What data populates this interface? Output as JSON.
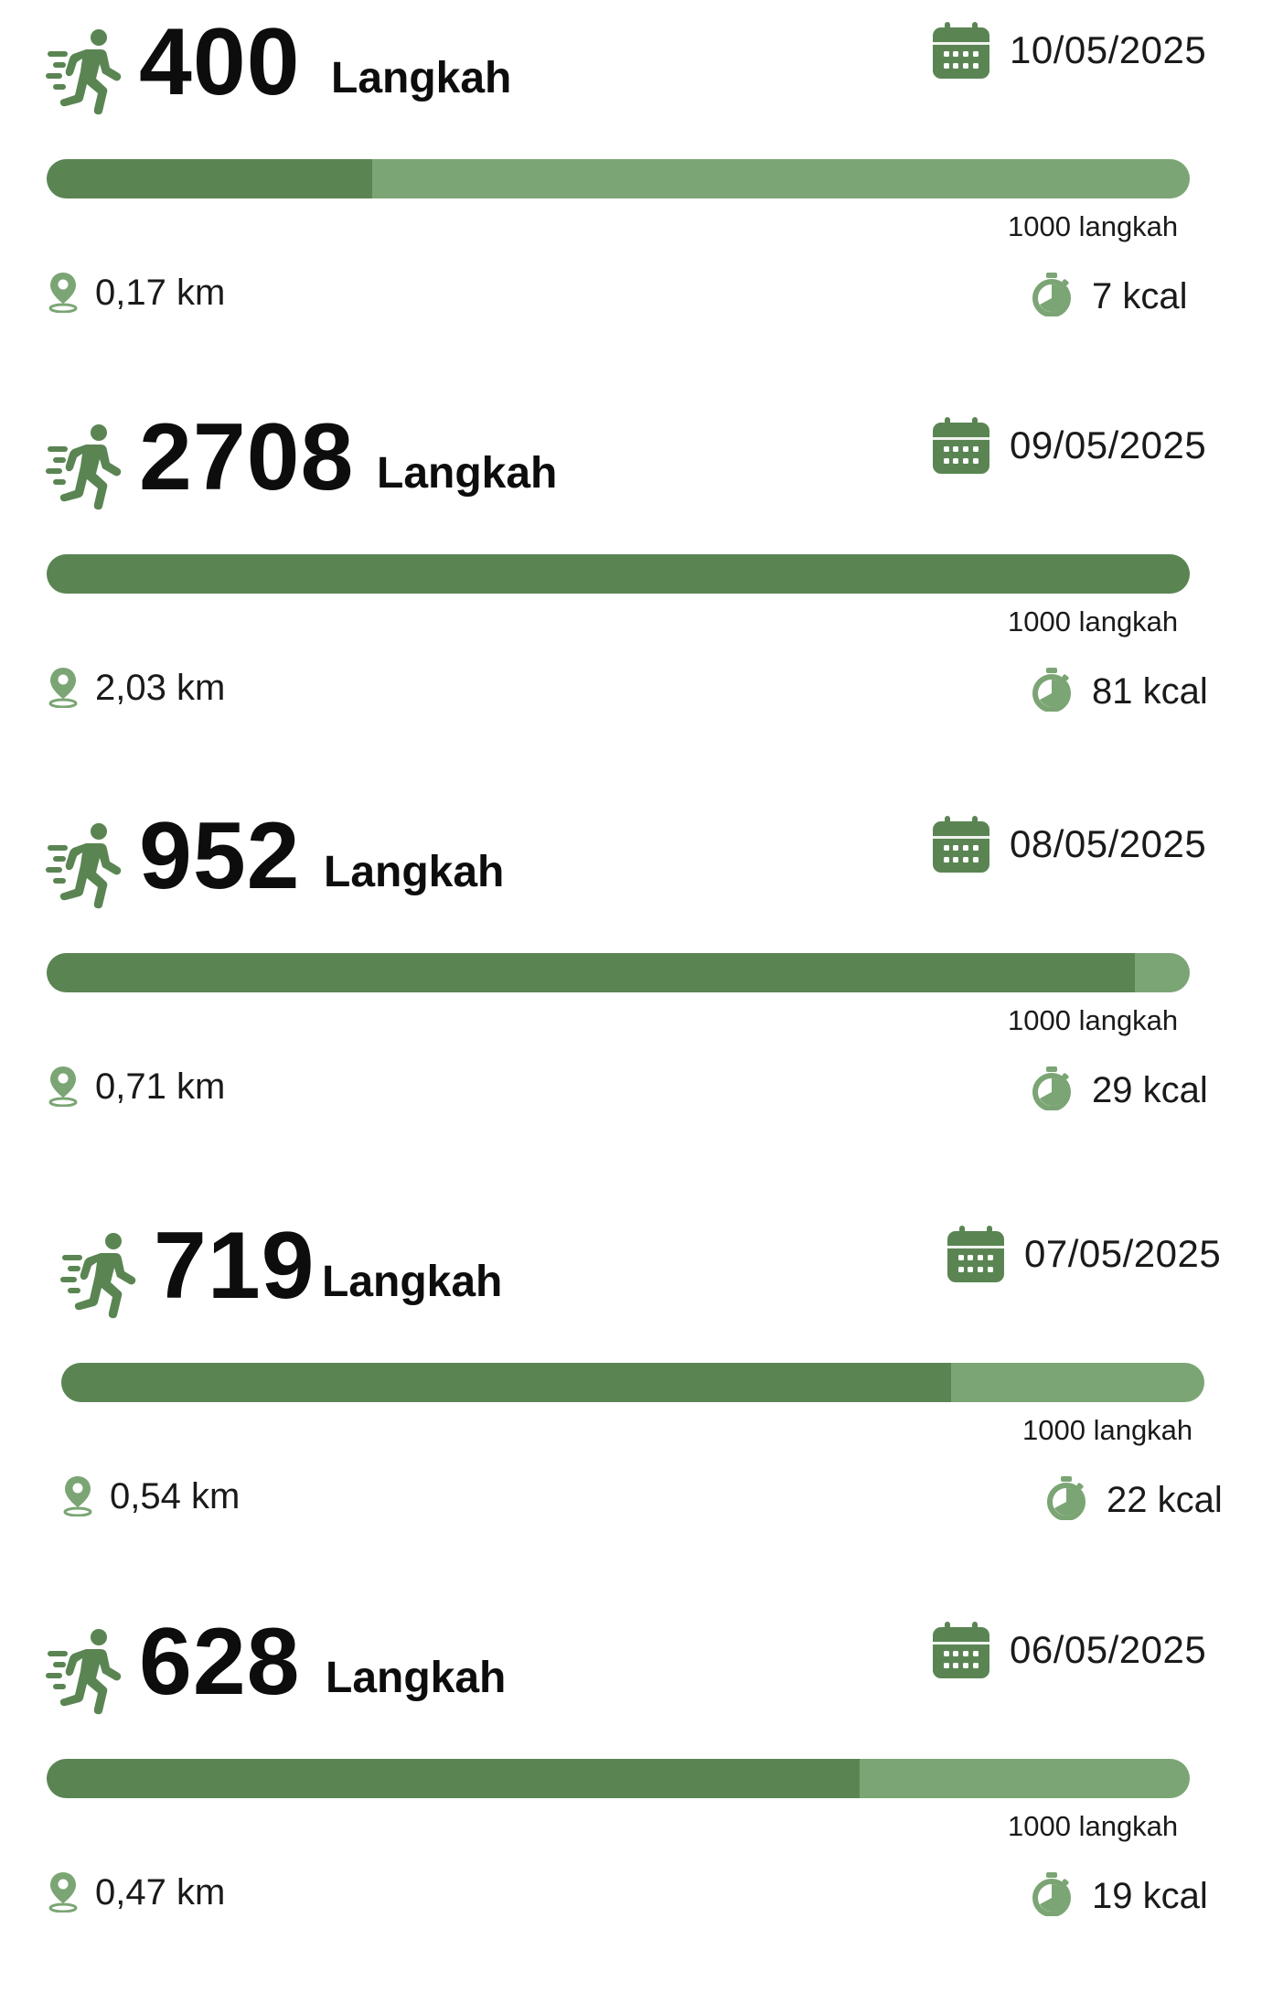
{
  "accent_colors": {
    "progress_fill": "#5a8553",
    "progress_track": "#7ba574",
    "icon": "#5a8553"
  },
  "icons": {
    "runner": "running-person-icon",
    "calendar": "calendar-icon",
    "distance": "location-pin-icon",
    "calories": "stopwatch-icon"
  },
  "entries": [
    {
      "steps": "400",
      "unit": "Langkah",
      "date": "10/05/2025",
      "goal_label": "1000 langkah",
      "progress_fraction": 0.285,
      "distance": "0,17 km",
      "calories": "7 kcal"
    },
    {
      "steps": "2708",
      "unit": "Langkah",
      "date": "09/05/2025",
      "goal_label": "1000 langkah",
      "progress_fraction": 1.0,
      "distance": "2,03 km",
      "calories": "81 kcal"
    },
    {
      "steps": "952",
      "unit": "Langkah",
      "date": "08/05/2025",
      "goal_label": "1000 langkah",
      "progress_fraction": 0.952,
      "distance": "0,71 km",
      "calories": "29 kcal"
    },
    {
      "steps": "719",
      "unit": "Langkah",
      "date": "07/05/2025",
      "goal_label": "1000 langkah",
      "progress_fraction": 0.778,
      "distance": "0,54 km",
      "calories": "22 kcal"
    },
    {
      "steps": "628",
      "unit": "Langkah",
      "date": "06/05/2025",
      "goal_label": "1000 langkah",
      "progress_fraction": 0.711,
      "distance": "0,47 km",
      "calories": "19 kcal"
    }
  ]
}
